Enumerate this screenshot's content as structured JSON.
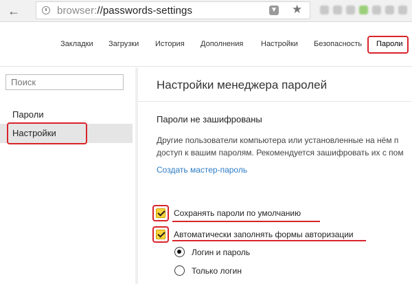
{
  "browser": {
    "url_scheme": "browser:",
    "url_path": "//passwords-settings",
    "extensions": [
      "ext-1",
      "ext-2",
      "ext-3",
      "ext-4",
      "ext-5",
      "ext-6",
      "ext-7"
    ]
  },
  "tabs": [
    {
      "label": "Закладки"
    },
    {
      "label": "Загрузки"
    },
    {
      "label": "История"
    },
    {
      "label": "Дополнения"
    },
    {
      "label": "Настройки"
    },
    {
      "label": "Безопасность"
    },
    {
      "label": "Пароли",
      "active": true
    }
  ],
  "sidebar": {
    "search_placeholder": "Поиск",
    "items": [
      {
        "label": "Пароли"
      },
      {
        "label": "Настройки",
        "selected": true
      }
    ]
  },
  "main": {
    "title": "Настройки менеджера паролей",
    "section_title": "Пароли не зашифрованы",
    "description_line1": "Другие пользователи компьютера или установленные на нём п",
    "description_line2": "доступ к вашим паролям. Рекомендуется зашифровать их с пом",
    "create_master_link": "Создать мастер-пароль",
    "checkboxes": [
      {
        "label": "Сохранять пароли по умолчанию",
        "checked": true
      },
      {
        "label": "Автоматически заполнять формы авторизации",
        "checked": true
      }
    ],
    "radios": [
      {
        "label": "Логин и пароль",
        "selected": true
      },
      {
        "label": "Только логин",
        "selected": false
      }
    ]
  },
  "colors": {
    "highlight": "#d8232a",
    "checkbox": "#ffd43b",
    "link": "#2d7cc6",
    "selected_item_bg": "#e5e5e5"
  }
}
